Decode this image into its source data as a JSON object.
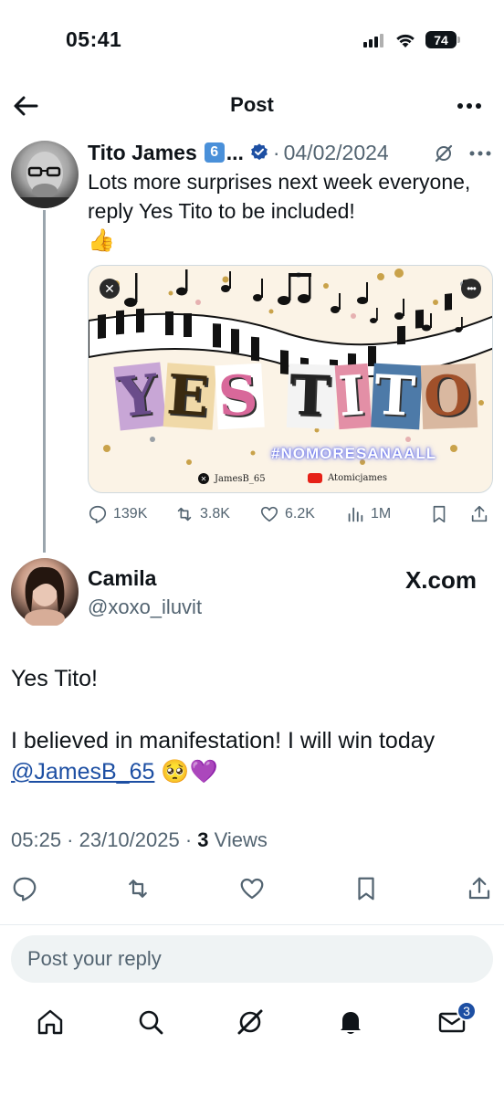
{
  "status_bar": {
    "time": "05:41",
    "battery": "74"
  },
  "nav": {
    "title": "Post"
  },
  "quoted": {
    "name": "Tito James",
    "badge": "6",
    "ellipsis": "...",
    "separator": "·",
    "date": "04/02/2024",
    "text": "Lots more surprises next week everyone, reply Yes Tito to be included!",
    "emoji": "👍",
    "media": {
      "title_letters": [
        "Y",
        "E",
        "S",
        "T",
        "I",
        "T",
        "O"
      ],
      "hashtag": "#NOMORESANAALL",
      "credit_x": "JamesB_65",
      "credit_yt": "Atomicjames"
    },
    "stats": {
      "replies": "139K",
      "reposts": "3.8K",
      "likes": "6.2K",
      "views": "1M"
    }
  },
  "post": {
    "name": "Camila",
    "handle": "@xoxo_iluvit",
    "source": "X.com",
    "line1": "Yes Tito!",
    "line2": "I believed in manifestation! I will win today",
    "mention": "@JamesB_65",
    "emojis": "🥺💜",
    "timestamp": "05:25 · 23/10/2025 · ",
    "views_count": "3",
    "views_label": " Views"
  },
  "reply": {
    "placeholder": "Post your reply"
  },
  "tabbar": {
    "messages_badge": "3"
  },
  "colors": {
    "link": "#1d4fa3",
    "muted": "#536471",
    "text": "#0f1419",
    "badge": "#1d4fa3"
  }
}
